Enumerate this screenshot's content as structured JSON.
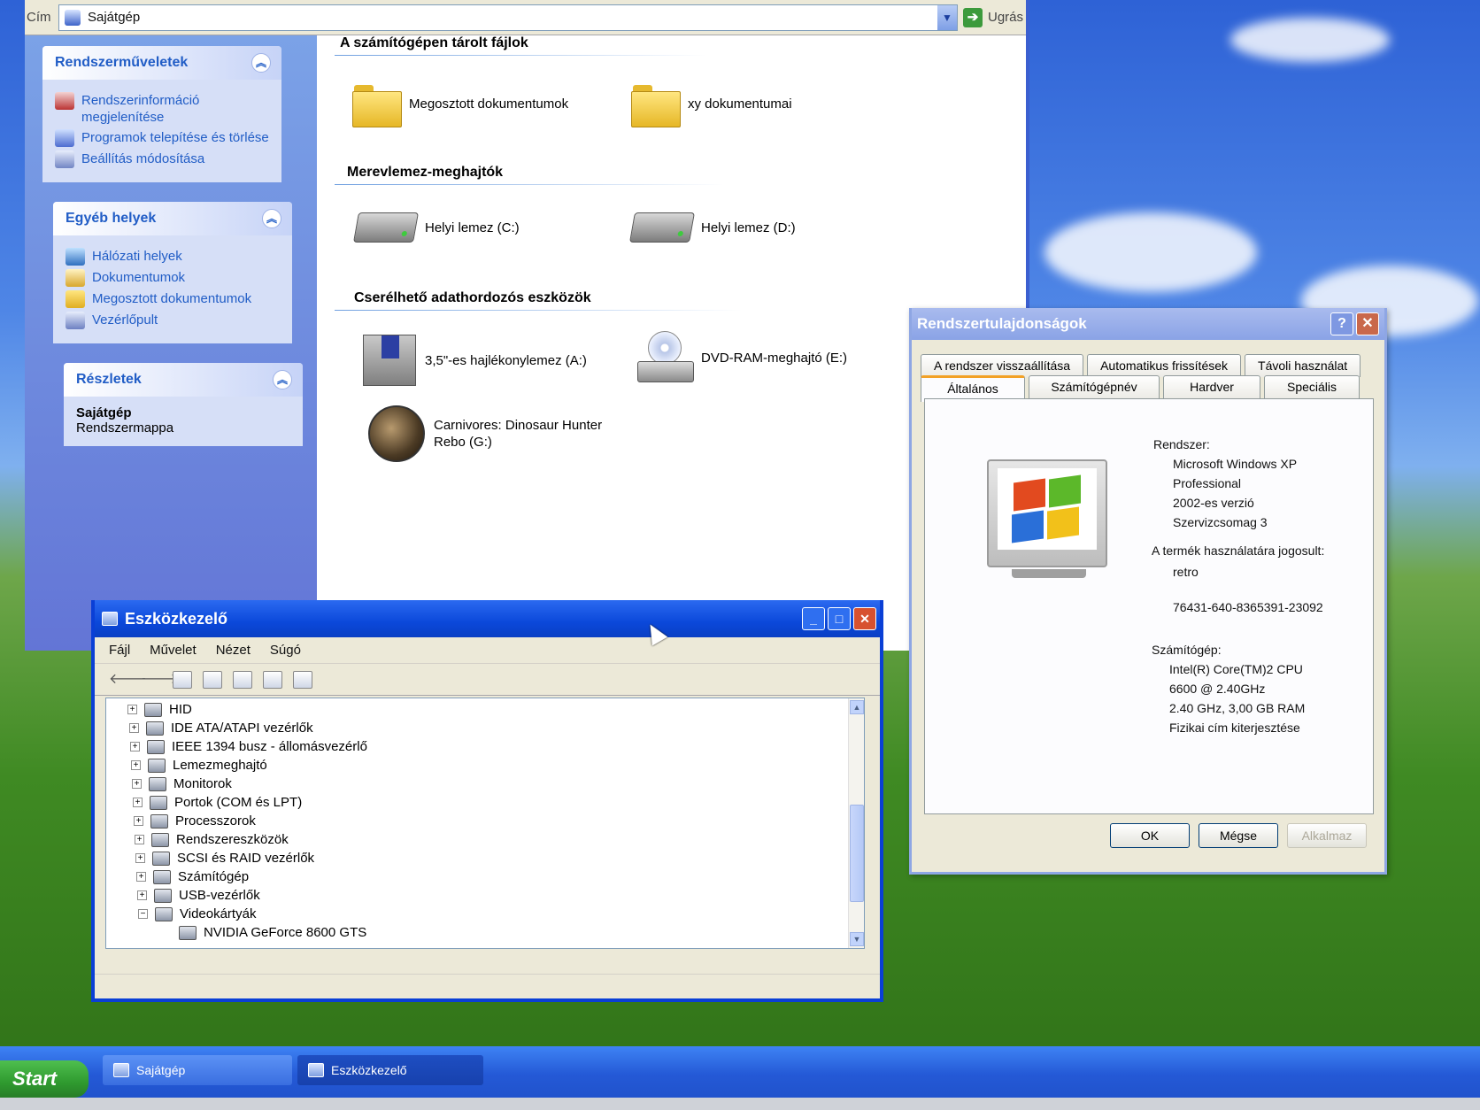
{
  "explorer": {
    "address_label": "Cím",
    "address_value": "Sajátgép",
    "go_label": "Ugrás",
    "tasks_panel": {
      "title": "Rendszerműveletek",
      "items": [
        {
          "label": "Rendszerinformáció megjelenítése",
          "icon": "system-info-icon"
        },
        {
          "label": "Programok telepítése és törlése",
          "icon": "add-remove-icon"
        },
        {
          "label": "Beállítás módosítása",
          "icon": "settings-icon"
        }
      ]
    },
    "places_panel": {
      "title": "Egyéb helyek",
      "items": [
        {
          "label": "Hálózati helyek",
          "icon": "network-icon"
        },
        {
          "label": "Dokumentumok",
          "icon": "documents-icon"
        },
        {
          "label": "Megosztott dokumentumok",
          "icon": "shared-folder-icon"
        },
        {
          "label": "Vezérlőpult",
          "icon": "control-panel-icon"
        }
      ]
    },
    "details_panel": {
      "title": "Részletek",
      "name": "Sajátgép",
      "type": "Rendszermappa"
    },
    "groups": {
      "files": "A számítógépen tárolt fájlok",
      "hdd": "Merevlemez-meghajtók",
      "removable": "Cserélhető adathordozós eszközök"
    },
    "items": {
      "shared_docs": "Megosztott dokumentumok",
      "user_docs": "xy dokumentumai",
      "drive_c": "Helyi lemez (C:)",
      "drive_d": "Helyi lemez (D:)",
      "floppy": "3,5\"-es hajlékonylemez (A:)",
      "dvd": "DVD-RAM-meghajtó (E:)",
      "game_line1": "Carnivores: Dinosaur Hunter",
      "game_line2": "Rebo (G:)"
    }
  },
  "sysprops": {
    "title": "Rendszertulajdonságok",
    "tabs_back": [
      "A rendszer visszaállítása",
      "Automatikus frissítések",
      "Távoli használat"
    ],
    "tabs_front": [
      "Általános",
      "Számítógépnév",
      "Hardver",
      "Speciális"
    ],
    "active_tab": "Általános",
    "system_label": "Rendszer:",
    "os_name": "Microsoft Windows XP",
    "os_edition": "Professional",
    "os_version": "2002-es verzió",
    "service_pack": "Szervizcsomag 3",
    "registered_label": "A termék használatára jogosult:",
    "registered_user": "retro",
    "product_id": "76431-640-8365391-23092",
    "computer_label": "Számítógép:",
    "cpu_line1": "Intel(R) Core(TM)2 CPU",
    "cpu_line2": "6600  @ 2.40GHz",
    "cpu_line3": "2.40 GHz, 3,00 GB RAM",
    "pae": "Fizikai cím kiterjesztése",
    "ok": "OK",
    "cancel": "Mégse",
    "apply": "Alkalmaz"
  },
  "devmgr": {
    "title": "Eszközkezelő",
    "menu": [
      "Fájl",
      "Művelet",
      "Nézet",
      "Súgó"
    ],
    "tree": [
      {
        "label": "HID",
        "expander": "+"
      },
      {
        "label": "IDE ATA/ATAPI vezérlők",
        "expander": "+"
      },
      {
        "label": "IEEE 1394 busz - állomásvezérlő",
        "expander": "+"
      },
      {
        "label": "Lemezmeghajtó",
        "expander": "+"
      },
      {
        "label": "Monitorok",
        "expander": "+"
      },
      {
        "label": "Portok (COM és LPT)",
        "expander": "+"
      },
      {
        "label": "Processzorok",
        "expander": "+"
      },
      {
        "label": "Rendszereszközök",
        "expander": "+"
      },
      {
        "label": "SCSI és RAID vezérlők",
        "expander": "+"
      },
      {
        "label": "Számítógép",
        "expander": "+"
      },
      {
        "label": "USB-vezérlők",
        "expander": "+"
      },
      {
        "label": "Videokártyák",
        "expander": "−"
      },
      {
        "label": "NVIDIA GeForce 8600 GTS",
        "expander": ""
      }
    ]
  },
  "taskbar": {
    "start": "Start",
    "buttons": [
      "Sajátgép",
      "Eszközkezelő"
    ]
  },
  "colors": {
    "xp_blue": "#0a3fd6",
    "link_blue": "#215dc6",
    "dialog_bg": "#ece9d8",
    "start_green": "#2f9a2f"
  }
}
